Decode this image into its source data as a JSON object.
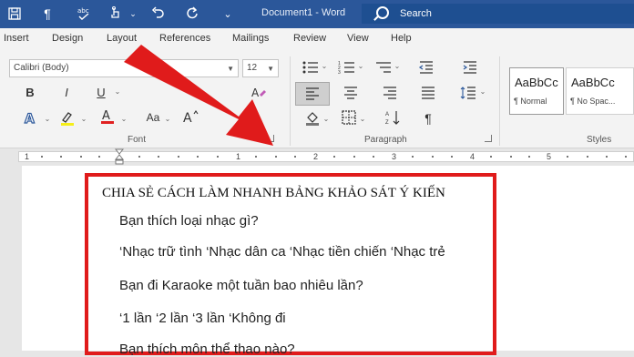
{
  "titlebar": {
    "document_title": "Document1 - Word",
    "search_placeholder": "Search",
    "icons": [
      "save-icon",
      "paragraph-mark-icon",
      "spelling-icon",
      "touch-mode-icon",
      "customize-chevron-icon",
      "undo-icon",
      "redo-icon",
      "customize-qat-icon"
    ]
  },
  "tabs": [
    "Insert",
    "Design",
    "Layout",
    "References",
    "Mailings",
    "Review",
    "View",
    "Help"
  ],
  "ribbon": {
    "font_name": "Calibri (Body)",
    "font_size": "12",
    "font_group_label": "Font",
    "paragraph_group_label": "Paragraph",
    "styles_group_label": "Styles",
    "bold": "B",
    "italic": "I",
    "underline": "U",
    "change_case": "Aa",
    "styles": [
      {
        "sample": "AaBbCc",
        "name": "¶ Normal"
      },
      {
        "sample": "AaBbCc",
        "name": "¶ No Spac..."
      }
    ]
  },
  "ruler": {
    "numbers": [
      "1",
      "1",
      "2",
      "3",
      "4",
      "5"
    ]
  },
  "document": {
    "title": "CHIA SẺ CÁCH LÀM NHANH BẢNG KHẢO SÁT Ý KIẾN",
    "lines": [
      "Bạn thích loại nhạc gì?",
      "‘Nhạc trữ tình ‘Nhạc dân ca ‘Nhạc tiền chiến ‘Nhạc trẻ",
      "Bạn đi Karaoke một tuần bao nhiêu lần?",
      "‘1 lần ‘2 lần ‘3 lần ‘Không đi",
      "Bạn thích môn thể thao nào?"
    ]
  },
  "colors": {
    "title_bar": "#2b579a",
    "highlight_border": "#e01b1b",
    "arrow": "#e01b1b"
  }
}
